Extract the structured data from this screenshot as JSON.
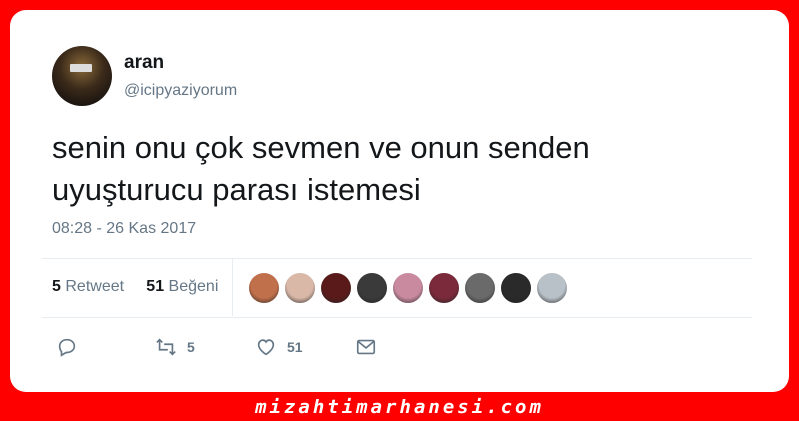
{
  "tweet": {
    "name": "aran",
    "handle": "@icipyaziyorum",
    "text_line1": "senin onu çok sevmen ve onun senden",
    "text_line2": "uyuşturucu parası istemesi",
    "timestamp": "08:28 - 26 Kas 2017"
  },
  "stats": {
    "retweet_count": "5",
    "retweet_label": "Retweet",
    "like_count": "51",
    "like_label": "Beğeni"
  },
  "liker_avatars": [
    "#c0704a",
    "#d9b8a8",
    "#5a1a1a",
    "#3a3a3a",
    "#c98aa0",
    "#7a2a3a",
    "#6a6a6a",
    "#2a2a2a",
    "#b8c0c8"
  ],
  "actions": {
    "reply_icon": "reply-icon",
    "retweet_icon": "retweet-icon",
    "retweet_count": "5",
    "like_icon": "heart-icon",
    "like_count": "51",
    "dm_icon": "envelope-icon"
  },
  "footer": {
    "watermark": "mizahtimarhanesi.com"
  }
}
